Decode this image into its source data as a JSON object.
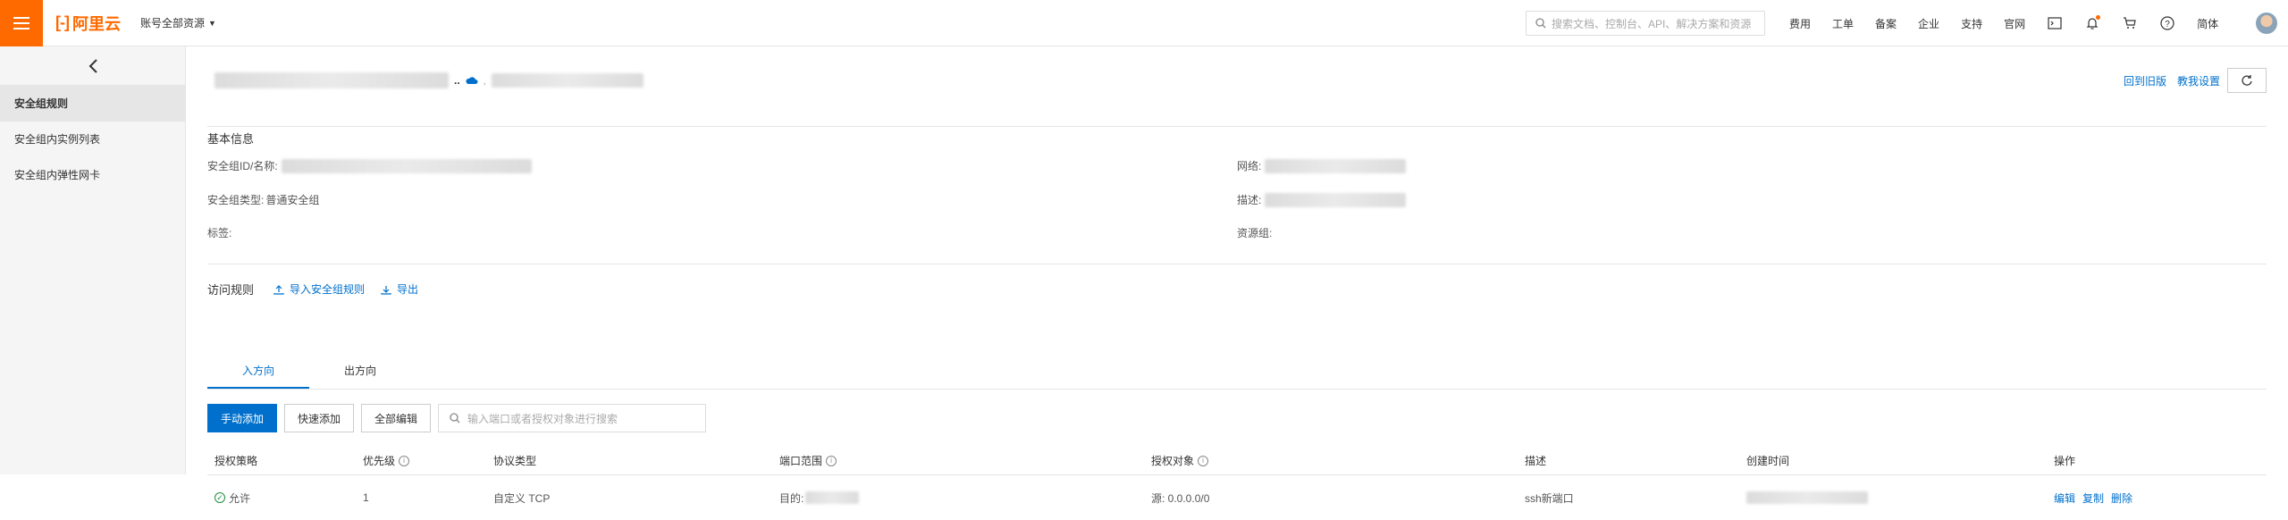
{
  "topbar": {
    "logo_text": "阿里云",
    "account_label": "账号全部资源",
    "search_placeholder": "搜索文档、控制台、API、解决方案和资源",
    "nav_items": [
      "费用",
      "工单",
      "备案",
      "企业",
      "支持",
      "官网"
    ],
    "language": "简体"
  },
  "sidebar": {
    "items": [
      {
        "label": "安全组规则",
        "active": true
      },
      {
        "label": "安全组内实例列表",
        "active": false
      },
      {
        "label": "安全组内弹性网卡",
        "active": false
      }
    ]
  },
  "header": {
    "back_old_label": "回到旧版",
    "tutorial_label": "教我设置"
  },
  "basic_info": {
    "title": "基本信息",
    "sg_id_label": "安全组ID/名称:",
    "network_label": "网络:",
    "sg_type_label": "安全组类型:",
    "sg_type_value": "普通安全组",
    "desc_label": "描述:",
    "tags_label": "标签:",
    "resource_group_label": "资源组:"
  },
  "access_rules": {
    "title": "访问规则",
    "import_label": "导入安全组规则",
    "export_label": "导出"
  },
  "tabs": [
    {
      "label": "入方向",
      "active": true
    },
    {
      "label": "出方向",
      "active": false
    }
  ],
  "toolbar": {
    "manual_add": "手动添加",
    "quick_add": "快速添加",
    "edit_all": "全部编辑",
    "search_placeholder": "输入端口或者授权对象进行搜索"
  },
  "table": {
    "columns": [
      "授权策略",
      "优先级",
      "协议类型",
      "端口范围",
      "授权对象",
      "描述",
      "创建时间",
      "操作"
    ],
    "rows": [
      {
        "policy": "允许",
        "priority": "1",
        "protocol": "自定义 TCP",
        "port_prefix": "目的:",
        "source": "源: 0.0.0.0/0",
        "description": "ssh新端口",
        "ops": [
          "编辑",
          "复制",
          "删除"
        ]
      }
    ]
  },
  "colors": {
    "brand": "#ff6a00",
    "link": "#0070cc",
    "success": "#1e8e3e"
  }
}
